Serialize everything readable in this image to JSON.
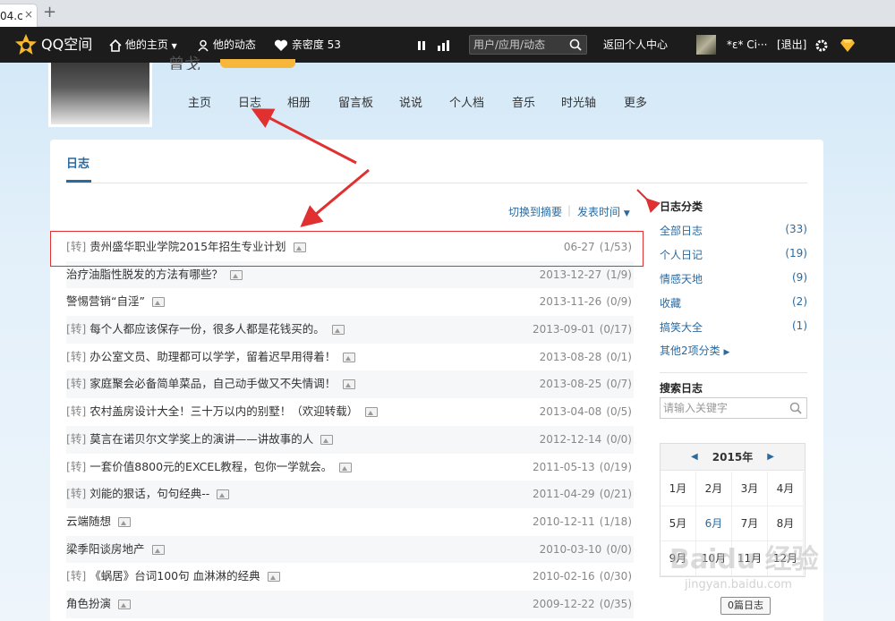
{
  "browser": {
    "tab_title": "04.c",
    "close": "×",
    "new_tab": "+"
  },
  "topbar": {
    "logo": "QQ空间",
    "home": "他的主页",
    "feed": "他的动态",
    "intimacy": "亲密度 53",
    "search_placeholder": "用户/应用/动态",
    "back_center": "返回个人中心",
    "username": "*ε* Ci···",
    "logout": "[退出]"
  },
  "profile": {
    "name": "曾戈"
  },
  "nav": [
    "主页",
    "日志",
    "相册",
    "留言板",
    "说说",
    "个人档",
    "音乐",
    "时光轴",
    "更多"
  ],
  "card": {
    "tab": "日志",
    "switch_summary": "切换到摘要",
    "sort_time": "发表时间"
  },
  "blogs": [
    {
      "tag": "[转]",
      "title": "贵州盛华职业学院2015年招生专业计划",
      "date": "06-27",
      "count": "(1/53)"
    },
    {
      "tag": "",
      "title": "治疗油脂性脱发的方法有哪些？",
      "date": "2013-12-27",
      "count": "(1/9)"
    },
    {
      "tag": "",
      "title": "警惕营销“自淫”",
      "date": "2013-11-26",
      "count": "(0/9)"
    },
    {
      "tag": "[转]",
      "title": "每个人都应该保存一份，很多人都是花钱买的。",
      "date": "2013-09-01",
      "count": "(0/17)"
    },
    {
      "tag": "[转]",
      "title": "办公室文员、助理都可以学学，留着迟早用得着！",
      "date": "2013-08-28",
      "count": "(0/1)"
    },
    {
      "tag": "[转]",
      "title": "家庭聚会必备简单菜品，自己动手做又不失情调！",
      "date": "2013-08-25",
      "count": "(0/7)"
    },
    {
      "tag": "[转]",
      "title": "农村盖房设计大全！三十万以内的别墅！（欢迎转载）",
      "date": "2013-04-08",
      "count": "(0/5)"
    },
    {
      "tag": "[转]",
      "title": "莫言在诺贝尔文学奖上的演讲——讲故事的人",
      "date": "2012-12-14",
      "count": "(0/0)"
    },
    {
      "tag": "[转]",
      "title": "一套价值8800元的EXCEL教程，包你一学就会。",
      "date": "2011-05-13",
      "count": "(0/19)"
    },
    {
      "tag": "[转]",
      "title": "刘能的狠话，句句经典--",
      "date": "2011-04-29",
      "count": "(0/21)"
    },
    {
      "tag": "",
      "title": "云端随想",
      "date": "2010-12-11",
      "count": "(1/18)"
    },
    {
      "tag": "",
      "title": "梁季阳谈房地产",
      "date": "2010-03-10",
      "count": "(0/0)"
    },
    {
      "tag": "[转]",
      "title": "《蜗居》台词100句 血淋淋的经典",
      "date": "2010-02-16",
      "count": "(0/30)"
    },
    {
      "tag": "",
      "title": "角色扮演",
      "date": "2009-12-22",
      "count": "(0/35)"
    }
  ],
  "sidebar": {
    "category_title": "日志分类",
    "categories": [
      {
        "label": "全部日志",
        "count": "(33)"
      },
      {
        "label": "个人日记",
        "count": "(19)"
      },
      {
        "label": "情感天地",
        "count": "(9)"
      },
      {
        "label": "收藏",
        "count": "(2)"
      },
      {
        "label": "搞笑大全",
        "count": "(1)"
      }
    ],
    "more_categories": "其他2项分类",
    "search_title": "搜索日志",
    "search_placeholder": "请输入关键字"
  },
  "calendar": {
    "year": "2015年",
    "months": [
      "1月",
      "2月",
      "3月",
      "4月",
      "5月",
      "6月",
      "7月",
      "8月",
      "9月",
      "10月",
      "11月",
      "12月"
    ],
    "active_month_index": 5,
    "tooltip": "0篇日志"
  },
  "watermark": {
    "brand": "Baidu 经验",
    "url": "jingyan.baidu.com"
  }
}
